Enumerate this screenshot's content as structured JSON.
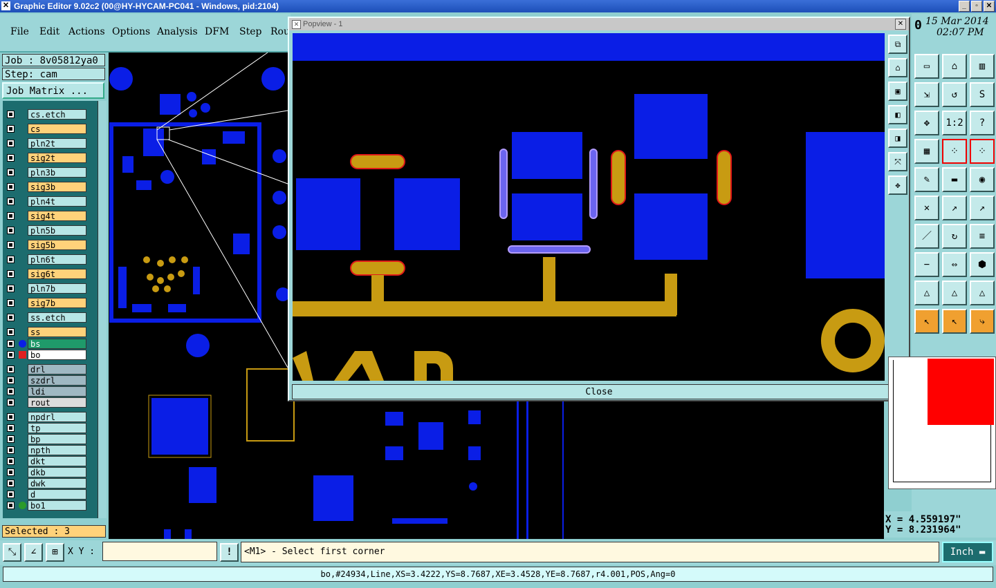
{
  "window": {
    "title": "Graphic Editor 9.02c2 (00@HY-HYCAM-PC041 - Windows, pid:2104)"
  },
  "menu": [
    "File",
    "Edit",
    "Actions",
    "Options",
    "Analysis",
    "DFM",
    "Step",
    "Rou"
  ],
  "job": {
    "job_label": "Job : 8v05812ya0",
    "step_label": "Step: cam",
    "matrix_button": "Job Matrix ..."
  },
  "layers": [
    {
      "name": "cs.etch",
      "color": "#b7e6e6"
    },
    {
      "name": "cs",
      "color": "#ffd27a"
    },
    {
      "name": "pln2t",
      "color": "#b7e6e6"
    },
    {
      "name": "sig2t",
      "color": "#ffd27a"
    },
    {
      "name": "pln3b",
      "color": "#b7e6e6"
    },
    {
      "name": "sig3b",
      "color": "#ffd27a"
    },
    {
      "name": "pln4t",
      "color": "#b7e6e6"
    },
    {
      "name": "sig4t",
      "color": "#ffd27a"
    },
    {
      "name": "pln5b",
      "color": "#b7e6e6"
    },
    {
      "name": "sig5b",
      "color": "#ffd27a"
    },
    {
      "name": "pln6t",
      "color": "#b7e6e6"
    },
    {
      "name": "sig6t",
      "color": "#ffd27a"
    },
    {
      "name": "pln7b",
      "color": "#b7e6e6"
    },
    {
      "name": "sig7b",
      "color": "#ffd27a"
    },
    {
      "name": "ss.etch",
      "color": "#b7e6e6"
    },
    {
      "name": "ss",
      "color": "#ffd27a"
    },
    {
      "name": "bs",
      "color": "#1f9a6a"
    },
    {
      "name": "bo",
      "color": "#ffffff"
    },
    {
      "name": "drl",
      "color": "#9fb8c2"
    },
    {
      "name": "szdrl",
      "color": "#9fb8c2"
    },
    {
      "name": "ldi",
      "color": "#9fb8c2"
    },
    {
      "name": "rout",
      "color": "#dcdcdc"
    },
    {
      "name": "npdrl",
      "color": "#b7e6e6"
    },
    {
      "name": "tp",
      "color": "#b7e6e6"
    },
    {
      "name": "bp",
      "color": "#b7e6e6"
    },
    {
      "name": "npth",
      "color": "#b7e6e6"
    },
    {
      "name": "dkt",
      "color": "#b7e6e6"
    },
    {
      "name": "dkb",
      "color": "#b7e6e6"
    },
    {
      "name": "dwk",
      "color": "#b7e6e6"
    },
    {
      "name": "d",
      "color": "#b7e6e6"
    },
    {
      "name": "bo1",
      "color": "#b7e6e6"
    }
  ],
  "selected": "Selected : 3",
  "popview": {
    "title": "Popview - 1",
    "close_label": "Close"
  },
  "datetime": {
    "date": "15 Mar 2014",
    "time": "02:07 PM",
    "indicator": "0"
  },
  "coords": {
    "x": "X =  4.559197\"",
    "y": "Y =  8.231964\""
  },
  "bottom": {
    "xy_label": "X Y :",
    "xy_value": "",
    "prompt": "<M1> - Select first corner",
    "unit": "Inch",
    "warn": "!"
  },
  "status": "bo,#24934,Line,XS=3.4222,YS=8.7687,XE=3.4528,YE=8.7687,r4.001,POS,Ang=0",
  "colors": {
    "pcb_blue": "#0a1ee6",
    "pcb_gold": "#c89b12",
    "panel": "#9cd6d8",
    "popview_close": "#b7e6e6"
  },
  "toolbar_icons": [
    "popview-zoom-icon",
    "home-icon",
    "window-icon",
    "zoom-in-icon",
    "zoom-out-icon",
    "stretch-icon",
    "pan-icon",
    "ratio-icon",
    "help-icon",
    "grid-icon",
    "snap-pad-icon",
    "snap-pad-red-icon",
    "edit-icon",
    "ruler-icon",
    "select-box-icon",
    "cross-icon",
    "snap-point-icon",
    "snap-center-icon",
    "line-icon",
    "arc-icon",
    "feature-icon",
    "minus-icon",
    "measure-icon",
    "components-icon",
    "triangle-icon",
    "triangle-a-icon",
    "triangle-b-icon",
    "pointer-icon",
    "pointer-select-icon",
    "route-icon"
  ]
}
